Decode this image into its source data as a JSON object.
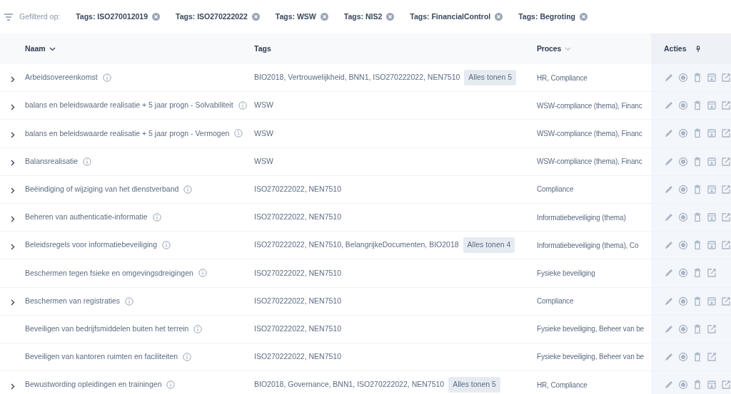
{
  "filter": {
    "label": "Gefilterd op:",
    "chips": [
      "Tags: ISO270012019",
      "Tags: ISO270222022",
      "Tags: WSW",
      "Tags: NIS2",
      "Tags: FinancialControl",
      "Tags: Begroting"
    ]
  },
  "table": {
    "columns": [
      {
        "label": "Naam",
        "kind": "sorted"
      },
      {
        "label": "Tags",
        "kind": "plain"
      },
      {
        "label": "Proces",
        "kind": "sortable"
      },
      {
        "label": "Acties",
        "kind": "pinned"
      }
    ],
    "rows": [
      {
        "expandable": true,
        "name": "Arbeidsovereenkomst",
        "tags": "BIO2018, Vertrouwelijkheid, BNN1, ISO270222022, NEN7510",
        "more": "Alles tonen 5",
        "proces": "HR, Compliance",
        "archivable": true
      },
      {
        "expandable": true,
        "name": "balans en beleidswaarde realisatie + 5 jaar progn - Solvabiliteit",
        "tags": "WSW",
        "proces": "WSW-compliance (thema), Financ",
        "archivable": true
      },
      {
        "expandable": true,
        "name": "balans en beleidswaarde realisatie + 5 jaar progn - Vermogen",
        "tags": "WSW",
        "proces": "WSW-compliance (thema), Financ",
        "archivable": true
      },
      {
        "expandable": true,
        "name": "Balansrealisatie",
        "tags": "WSW",
        "proces": "WSW-compliance (thema), Financ",
        "archivable": true
      },
      {
        "expandable": true,
        "name": "Beëindiging of wijziging van het dienstverband",
        "tags": "ISO270222022, NEN7510",
        "proces": "Compliance",
        "archivable": true
      },
      {
        "expandable": true,
        "name": "Beheren van authenticatie-informatie",
        "tags": "ISO270222022, NEN7510",
        "proces": "Informatiebeveiliging (thema)",
        "archivable": true
      },
      {
        "expandable": true,
        "name": "Beleidsregels voor informatiebeveiliging",
        "tags": "ISO270222022, NEN7510, BelangrijkeDocumenten, BIO2018",
        "more": "Alles tonen 4",
        "proces": "Informatiebeveiliging (thema), Co",
        "archivable": true
      },
      {
        "expandable": false,
        "name": "Beschermen tegen fsieke en omgevingsdreigingen",
        "tags": "ISO270222022, NEN7510",
        "proces": "Fysieke beveiliging",
        "archivable": false
      },
      {
        "expandable": true,
        "name": "Beschermen van registraties",
        "tags": "ISO270222022, NEN7510",
        "proces": "Compliance",
        "archivable": true
      },
      {
        "expandable": false,
        "name": "Beveiligen van bedrijfsmiddelen buiten het terrein",
        "tags": "ISO270222022, NEN7510",
        "proces": "Fysieke beveiliging, Beheer van be",
        "archivable": false
      },
      {
        "expandable": false,
        "name": "Beveiligen van kantoren ruimten en faciliteiten",
        "tags": "ISO270222022, NEN7510",
        "proces": "Fysieke beveiliging, Beheer van be",
        "archivable": false
      },
      {
        "expandable": true,
        "name": "Bewustwording opleidingen en trainingen",
        "tags": "BIO2018, Governance, BNN1, ISO270222022, NEN7510",
        "more": "Alles tonen 5",
        "proces": "HR, Compliance",
        "archivable": true
      }
    ]
  }
}
